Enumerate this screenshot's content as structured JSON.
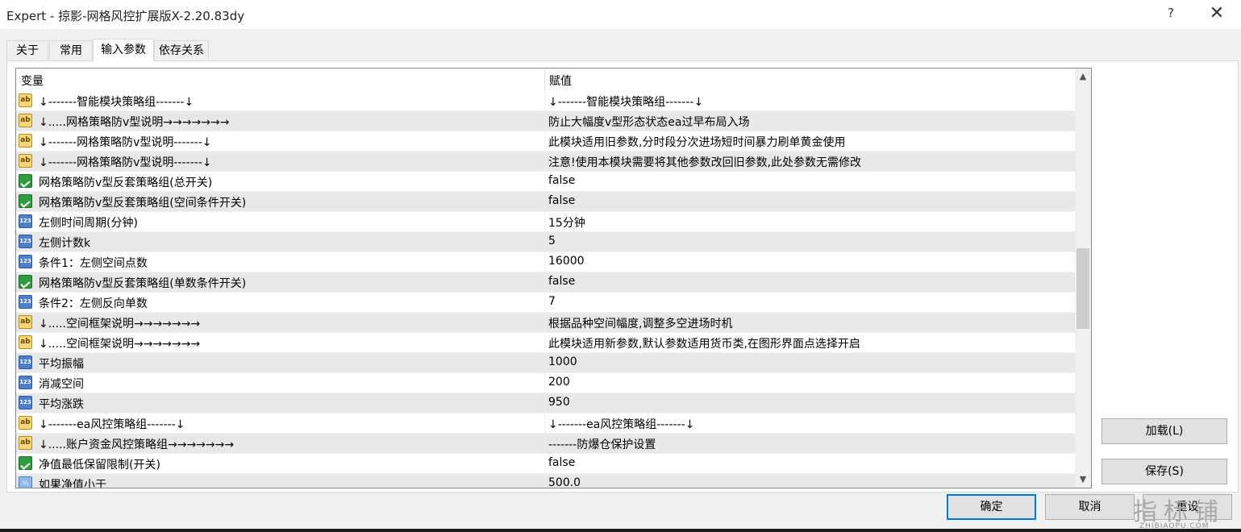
{
  "window": {
    "title": "Expert - 掠影-网格风控扩展版X-2.20.83dy",
    "help_glyph": "?",
    "close_glyph": "✕"
  },
  "tabs": [
    {
      "label": "关于"
    },
    {
      "label": "常用"
    },
    {
      "label": "输入参数",
      "active": true
    },
    {
      "label": "依存关系"
    }
  ],
  "grid": {
    "col_variable": "变量",
    "col_value": "赋值",
    "rows": [
      {
        "type": "string",
        "icon": "ab-icon",
        "name": "↓-------智能模块策略组-------↓",
        "value": "↓-------智能模块策略组-------↓"
      },
      {
        "type": "string",
        "icon": "ab-icon",
        "name": "↓.....网格策略防v型说明→→→→→→→",
        "value": "防止大幅度v型形态状态ea过早布局入场"
      },
      {
        "type": "string",
        "icon": "ab-icon",
        "name": "↓-------网格策略防v型说明-------↓",
        "value": "此模块适用旧参数,分时段分次进场短时间暴力刷单黄金使用"
      },
      {
        "type": "string",
        "icon": "ab-icon",
        "name": "↓-------网格策略防v型说明-------↓",
        "value": "注意!使用本模块需要将其他参数改回旧参数,此处参数无需修改"
      },
      {
        "type": "bool",
        "icon": "bool-icon",
        "name": "网格策略防v型反套策略组(总开关)",
        "value": "false"
      },
      {
        "type": "bool",
        "icon": "bool-icon",
        "name": "网格策略防v型反套策略组(空间条件开关)",
        "value": "false"
      },
      {
        "type": "int",
        "icon": "int-icon",
        "name": "左侧时间周期(分钟)",
        "value": "15分钟"
      },
      {
        "type": "int",
        "icon": "int-icon",
        "name": "左侧计数k",
        "value": "5"
      },
      {
        "type": "int",
        "icon": "int-icon",
        "name": "条件1：左侧空间点数",
        "value": "16000"
      },
      {
        "type": "bool",
        "icon": "bool-icon",
        "name": "网格策略防v型反套策略组(单数条件开关)",
        "value": "false"
      },
      {
        "type": "int",
        "icon": "int-icon",
        "name": "条件2：左侧反向单数",
        "value": "7"
      },
      {
        "type": "string",
        "icon": "ab-icon",
        "name": "↓.....空间框架说明→→→→→→→",
        "value": "根据品种空间幅度,调整多空进场时机"
      },
      {
        "type": "string",
        "icon": "ab-icon",
        "name": "↓.....空间框架说明→→→→→→→",
        "value": "此模块适用新参数,默认参数适用货币类,在图形界面点选择开启"
      },
      {
        "type": "int",
        "icon": "int-icon",
        "name": "平均振幅",
        "value": "1000"
      },
      {
        "type": "int",
        "icon": "int-icon",
        "name": "消减空间",
        "value": "200"
      },
      {
        "type": "int",
        "icon": "int-icon",
        "name": "平均涨跌",
        "value": "950"
      },
      {
        "type": "string",
        "icon": "ab-icon",
        "name": "↓-------ea风控策略组-------↓",
        "value": "↓-------ea风控策略组-------↓"
      },
      {
        "type": "string",
        "icon": "ab-icon",
        "name": "↓.....账户资金风控策略组→→→→→→→",
        "value": "-------防爆仓保护设置"
      },
      {
        "type": "bool",
        "icon": "bool-icon",
        "name": "净值最低保留限制(开关)",
        "value": "false"
      },
      {
        "type": "double",
        "icon": "double-icon",
        "name": "如果净值小于",
        "value": "500.0"
      }
    ]
  },
  "icon_glyphs": {
    "ab": "ab",
    "int": "123",
    "double": "½"
  },
  "scrollbar": {
    "up": "▲",
    "down": "▼"
  },
  "buttons": {
    "load": "加载(L)",
    "save": "保存(S)",
    "ok": "确定",
    "cancel": "取消",
    "reset": "重设"
  },
  "watermark": {
    "top": "指标铺",
    "bottom": "ZHIBIAOPU.COM"
  }
}
